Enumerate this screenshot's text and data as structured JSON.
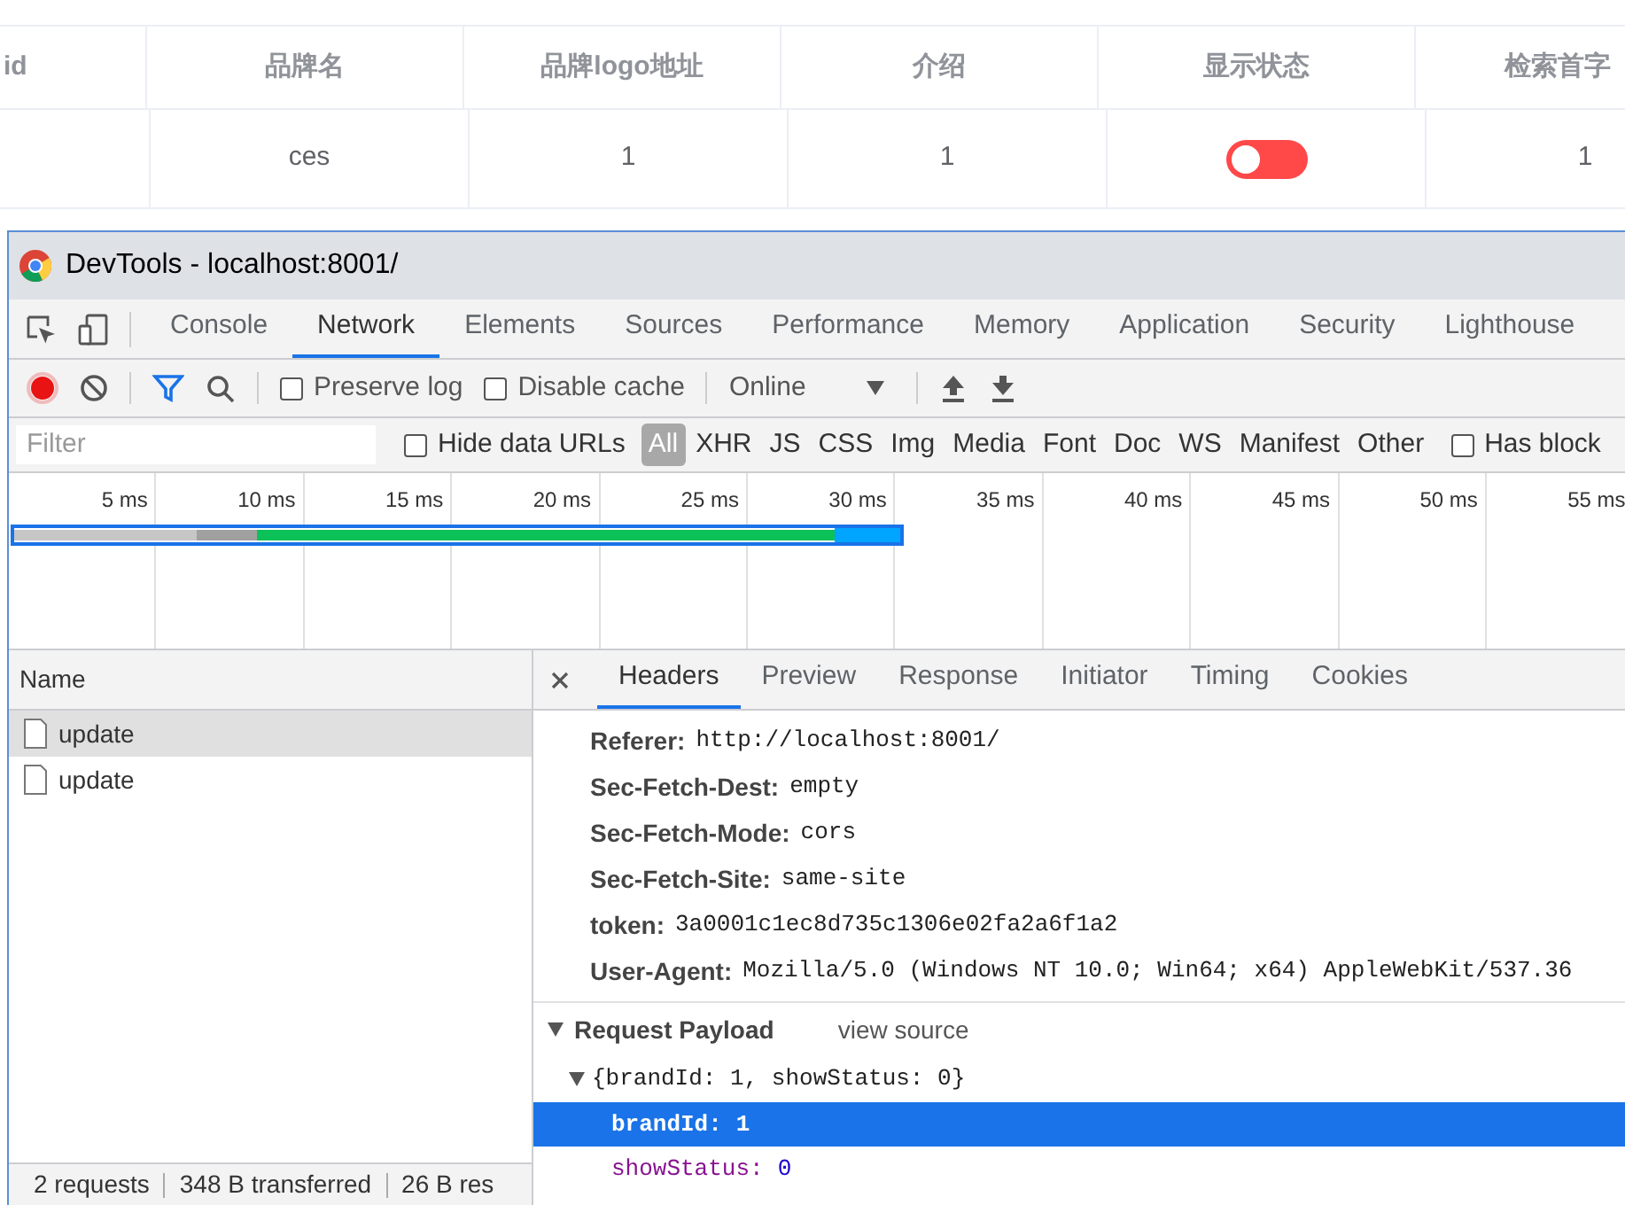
{
  "table": {
    "columns": [
      "id",
      "品牌名",
      "品牌logo地址",
      "介绍",
      "显示状态",
      "检索首字"
    ],
    "rows": [
      {
        "name": "ces",
        "logo": "1",
        "intro": "1",
        "show_status": {
          "on": false
        },
        "first_letter": "1"
      }
    ]
  },
  "devtools": {
    "title": "DevTools - localhost:8001/",
    "tabs": [
      {
        "label": "Console",
        "selected": false
      },
      {
        "label": "Network",
        "selected": true
      },
      {
        "label": "Elements",
        "selected": false
      },
      {
        "label": "Sources",
        "selected": false
      },
      {
        "label": "Performance",
        "selected": false
      },
      {
        "label": "Memory",
        "selected": false
      },
      {
        "label": "Application",
        "selected": false
      },
      {
        "label": "Security",
        "selected": false
      },
      {
        "label": "Lighthouse",
        "selected": false
      }
    ],
    "toolbar": {
      "recording": true,
      "preserve_log": {
        "label": "Preserve log",
        "checked": false
      },
      "disable_cache": {
        "label": "Disable cache",
        "checked": false
      },
      "throttling": "Online"
    },
    "filter": {
      "placeholder": "Filter",
      "hide_data_urls": {
        "label": "Hide data URLs",
        "checked": false
      },
      "types": [
        {
          "label": "All",
          "selected": true
        },
        {
          "label": "XHR",
          "selected": false
        },
        {
          "label": "JS",
          "selected": false
        },
        {
          "label": "CSS",
          "selected": false
        },
        {
          "label": "Img",
          "selected": false
        },
        {
          "label": "Media",
          "selected": false
        },
        {
          "label": "Font",
          "selected": false
        },
        {
          "label": "Doc",
          "selected": false
        },
        {
          "label": "WS",
          "selected": false
        },
        {
          "label": "Manifest",
          "selected": false
        },
        {
          "label": "Other",
          "selected": false
        }
      ],
      "has_blocked": {
        "label": "Has block",
        "checked": false
      }
    },
    "timeline_ticks": [
      "5 ms",
      "10 ms",
      "15 ms",
      "20 ms",
      "25 ms",
      "30 ms",
      "35 ms",
      "40 ms",
      "45 ms",
      "50 ms",
      "55 ms"
    ],
    "requests": {
      "column": "Name",
      "items": [
        {
          "name": "update",
          "selected": true
        },
        {
          "name": "update",
          "selected": false
        }
      ]
    },
    "status_bar": [
      "2 requests",
      "348 B transferred",
      "26 B res"
    ],
    "detail_tabs": [
      {
        "label": "Headers",
        "selected": true
      },
      {
        "label": "Preview",
        "selected": false
      },
      {
        "label": "Response",
        "selected": false
      },
      {
        "label": "Initiator",
        "selected": false
      },
      {
        "label": "Timing",
        "selected": false
      },
      {
        "label": "Cookies",
        "selected": false
      }
    ],
    "headers": [
      {
        "name": "Referer:",
        "value": "http://localhost:8001/"
      },
      {
        "name": "Sec-Fetch-Dest:",
        "value": "empty"
      },
      {
        "name": "Sec-Fetch-Mode:",
        "value": "cors"
      },
      {
        "name": "Sec-Fetch-Site:",
        "value": "same-site"
      },
      {
        "name": "token:",
        "value": "3a0001c1ec8d735c1306e02fa2a6f1a2"
      },
      {
        "name": "User-Agent:",
        "value": "Mozilla/5.0 (Windows NT 10.0; Win64; x64) AppleWebKit/537.36"
      }
    ],
    "payload": {
      "title": "Request Payload",
      "view_source": "view source",
      "expanded": true,
      "summary": "{brandId: 1, showStatus: 0}",
      "fields": [
        {
          "key": "brandId:",
          "value": "1",
          "selected": true
        },
        {
          "key": "showStatus:",
          "value": "0",
          "selected": false
        }
      ]
    }
  }
}
